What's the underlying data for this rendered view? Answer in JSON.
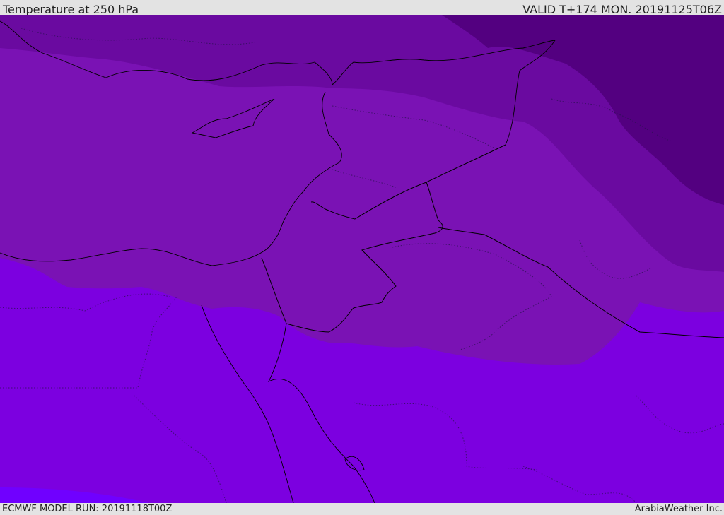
{
  "header": {
    "title": "Temperature at 250 hPa",
    "valid": "VALID T+174 MON. 20191125T06Z"
  },
  "footer": {
    "run": "ECMWF MODEL RUN: 20191118T00Z",
    "credit": "ArabiaWeather Inc."
  },
  "colors": {
    "band_darkest": "#530080",
    "band_dark": "#6a0aa0",
    "band_mid": "#7a12b4",
    "band_light": "#7c00e0",
    "band_lightest": "#7000ff"
  }
}
